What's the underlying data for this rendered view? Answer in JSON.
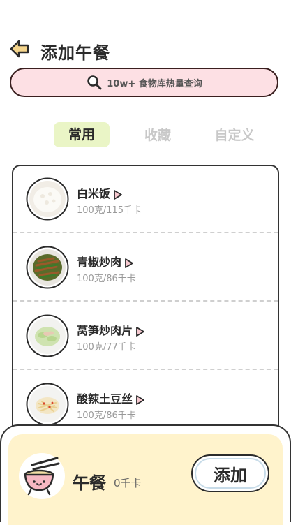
{
  "header": {
    "title": "添加午餐",
    "back_icon": "arrow-left-icon"
  },
  "search": {
    "text": "10w+ 食物库热量查询",
    "icon": "search-icon"
  },
  "tabs": [
    {
      "label": "常用",
      "active": true
    },
    {
      "label": "收藏",
      "active": false
    },
    {
      "label": "自定义",
      "active": false
    }
  ],
  "foods": [
    {
      "name": "白米饭",
      "kcal": "100克/115千卡"
    },
    {
      "name": "青椒炒肉",
      "kcal": "100克/86千卡"
    },
    {
      "name": "莴笋炒肉片",
      "kcal": "100克/77千卡"
    },
    {
      "name": "酸辣土豆丝",
      "kcal": "100克/86千卡"
    }
  ],
  "bottom": {
    "meal": "午餐",
    "kcal": "0千卡",
    "add_label": "添加"
  },
  "colors": {
    "search_bg": "#fde0e4",
    "active_tab_bg": "#eaf5c6",
    "panel_bg": "#fff3cc",
    "back_arrow": "#f5d58c"
  }
}
